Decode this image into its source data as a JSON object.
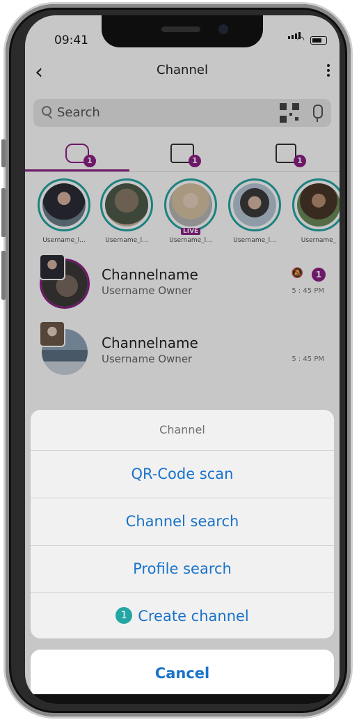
{
  "status_bar": {
    "time": "09:41"
  },
  "header": {
    "title": "Channel"
  },
  "search": {
    "placeholder": "Search"
  },
  "tabs": [
    {
      "name": "chats",
      "badge": "1"
    },
    {
      "name": "favorites",
      "badge": "1"
    },
    {
      "name": "profile",
      "badge": "1"
    }
  ],
  "stories": [
    {
      "label": "Username_l...",
      "live": ""
    },
    {
      "label": "Username_l...",
      "live": ""
    },
    {
      "label": "Username_l...",
      "live": "LIVE"
    },
    {
      "label": "Username_l...",
      "live": ""
    },
    {
      "label": "Username_",
      "live": ""
    }
  ],
  "channels": [
    {
      "name": "Channelname",
      "subtitle": "Username Owner",
      "time": "5 : 45 PM",
      "badge": "1"
    },
    {
      "name": "Channelname",
      "subtitle": "Username Owner",
      "time": "5 : 45 PM"
    }
  ],
  "sheet": {
    "title": "Channel",
    "items": [
      "QR-Code scan",
      "Channel search",
      "Profile search",
      "Create channel"
    ],
    "create_step": "1",
    "cancel": "Cancel"
  },
  "colors": {
    "accent_purple": "#8e1f86",
    "accent_teal": "#24a6a3",
    "link_blue": "#1a73c9"
  }
}
